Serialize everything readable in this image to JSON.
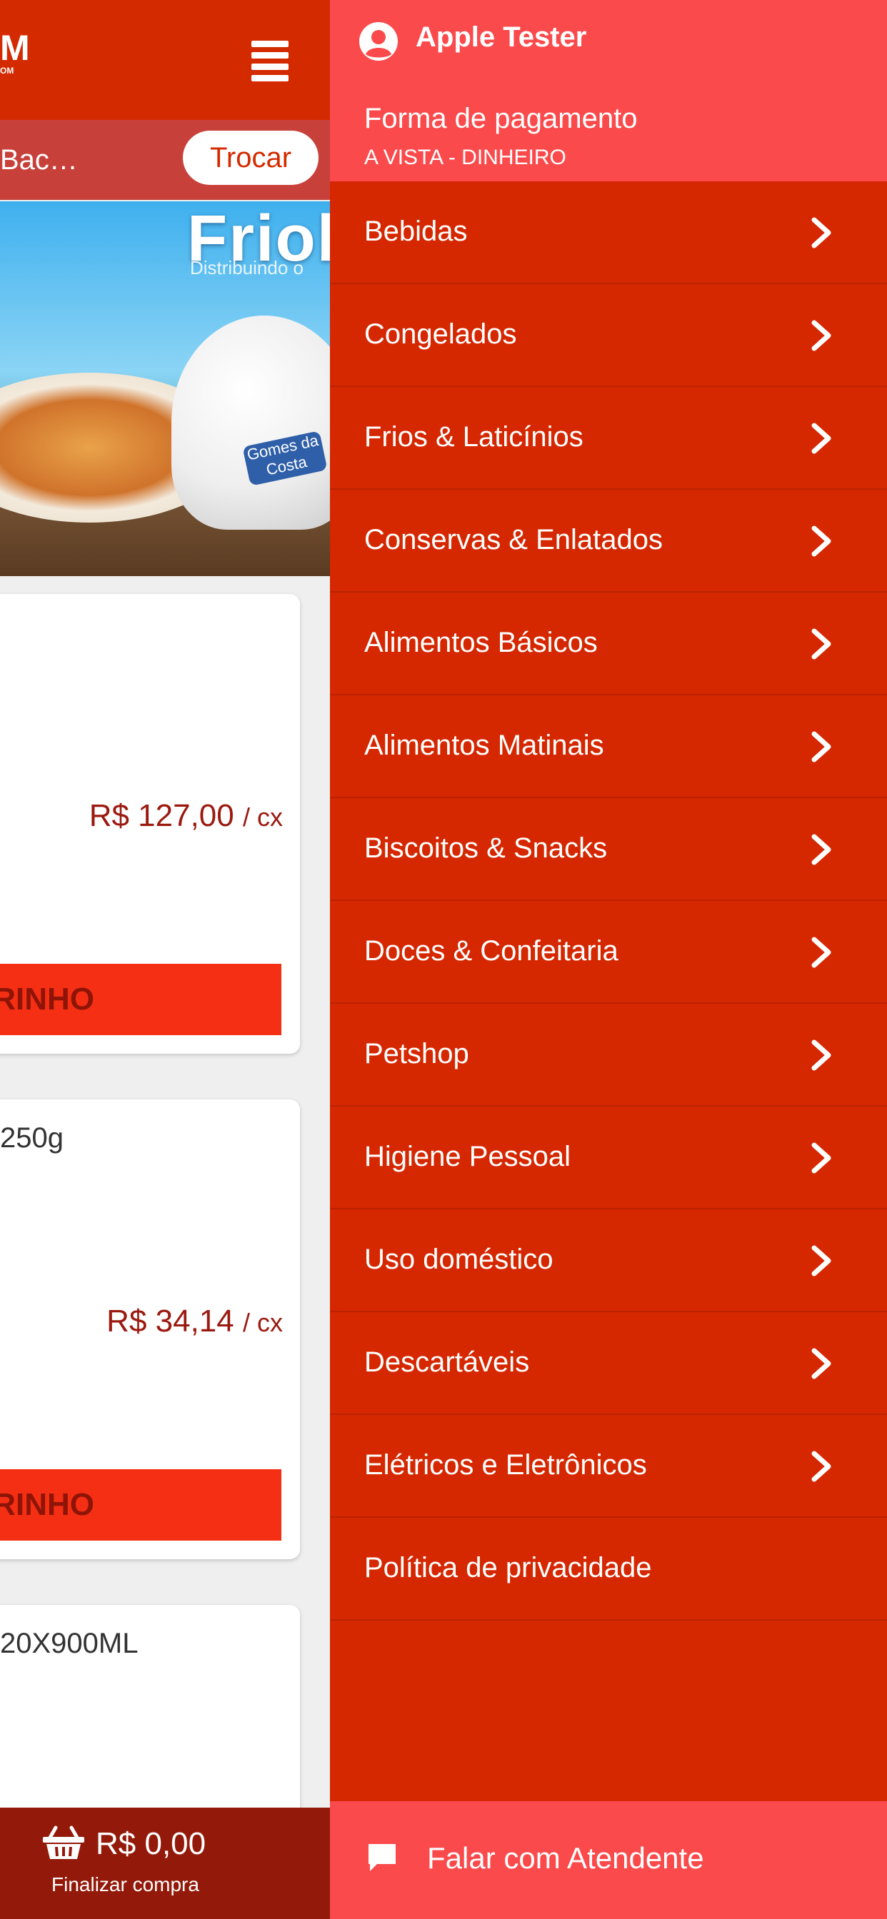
{
  "colors": {
    "topbar": "#d42a00",
    "drawer": "#d52700",
    "drawer_header": "#fa4a4c",
    "add_button": "#f52f13",
    "price_text": "#9b1a10",
    "cart_bar": "#931a0a"
  },
  "app": {
    "logo": {
      "mark": "M",
      "sub": "OM"
    },
    "menu_icon": "hamburger-icon",
    "store_name": "Bac…",
    "change_store_button": "Trocar",
    "banner": {
      "title": "Friob",
      "subtitle": "Distribuindo o",
      "brand": "Gomes da Costa"
    },
    "products": [
      {
        "name": "",
        "price": "R$ 127,00",
        "unit": "/ cx",
        "add_button": "RINHO"
      },
      {
        "name": "250g",
        "price": "R$ 34,14",
        "unit": "/ cx",
        "add_button": "RINHO"
      },
      {
        "name": "20X900ML",
        "price": "",
        "unit": "",
        "add_button": ""
      }
    ],
    "cart": {
      "icon": "basket-icon",
      "total": "R$ 0,00",
      "caption": "Finalizar compra"
    }
  },
  "drawer": {
    "user": {
      "icon": "user-circle-icon",
      "name": "Apple Tester"
    },
    "payment": {
      "label": "Forma de pagamento",
      "value": "A VISTA - DINHEIRO"
    },
    "menu_items": [
      {
        "label": "Bebidas",
        "has_chevron": true
      },
      {
        "label": "Congelados",
        "has_chevron": true
      },
      {
        "label": "Frios & Laticínios",
        "has_chevron": true
      },
      {
        "label": "Conservas & Enlatados",
        "has_chevron": true
      },
      {
        "label": "Alimentos Básicos",
        "has_chevron": true
      },
      {
        "label": "Alimentos Matinais",
        "has_chevron": true
      },
      {
        "label": "Biscoitos & Snacks",
        "has_chevron": true
      },
      {
        "label": "Doces & Confeitaria",
        "has_chevron": true
      },
      {
        "label": "Petshop",
        "has_chevron": true
      },
      {
        "label": "Higiene Pessoal",
        "has_chevron": true
      },
      {
        "label": "Uso doméstico",
        "has_chevron": true
      },
      {
        "label": "Descartáveis",
        "has_chevron": true
      },
      {
        "label": "Elétricos e Eletrônicos",
        "has_chevron": true
      },
      {
        "label": "Política de privacidade",
        "has_chevron": false
      }
    ],
    "chat": {
      "icon": "chat-bubble-icon",
      "label": "Falar com Atendente"
    }
  }
}
